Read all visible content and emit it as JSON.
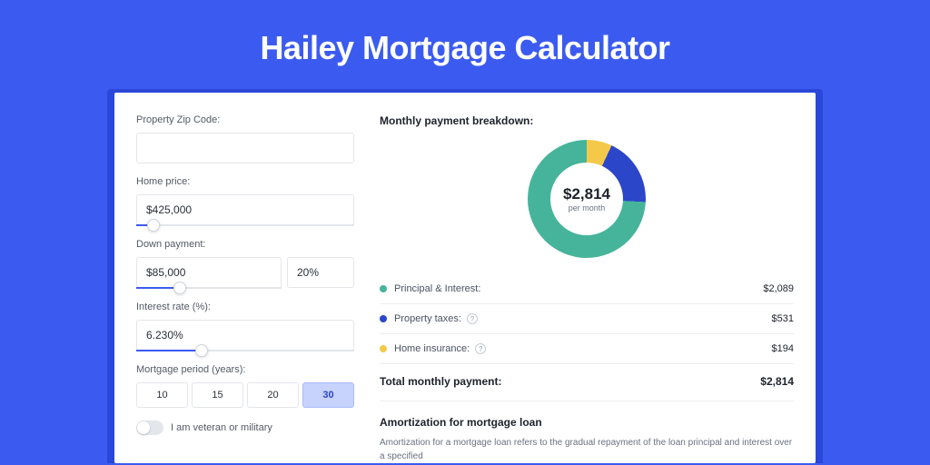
{
  "page_title": "Hailey Mortgage Calculator",
  "form": {
    "zip": {
      "label": "Property Zip Code:",
      "value": ""
    },
    "home_price": {
      "label": "Home price:",
      "value": "$425,000",
      "slider_pct": 8
    },
    "down_payment": {
      "label": "Down payment:",
      "amount": "$85,000",
      "pct": "20%",
      "slider_pct": 20
    },
    "interest_rate": {
      "label": "Interest rate (%):",
      "value": "6.230%",
      "slider_pct": 30
    },
    "period": {
      "label": "Mortgage period (years):",
      "options": [
        "10",
        "15",
        "20",
        "30"
      ],
      "active_index": 3
    },
    "veteran": {
      "label": "I am veteran or military",
      "on": false
    }
  },
  "breakdown": {
    "title": "Monthly payment breakdown:",
    "center_amount": "$2,814",
    "center_sub": "per month",
    "items": [
      {
        "label": "Principal & Interest:",
        "value": "$2,089",
        "color": "green",
        "help": false
      },
      {
        "label": "Property taxes:",
        "value": "$531",
        "color": "blue",
        "help": true
      },
      {
        "label": "Home insurance:",
        "value": "$194",
        "color": "yellow",
        "help": true
      }
    ],
    "total_label": "Total monthly payment:",
    "total_value": "$2,814"
  },
  "chart_data": {
    "type": "pie",
    "title": "Monthly payment breakdown",
    "series": [
      {
        "name": "Principal & Interest",
        "value": 2089,
        "color": "#46b49a"
      },
      {
        "name": "Property taxes",
        "value": 531,
        "color": "#2b46c9"
      },
      {
        "name": "Home insurance",
        "value": 194,
        "color": "#f4c94a"
      }
    ],
    "total": 2814,
    "center_label": "$2,814 per month"
  },
  "amortization": {
    "title": "Amortization for mortgage loan",
    "body": "Amortization for a mortgage loan refers to the gradual repayment of the loan principal and interest over a specified"
  }
}
